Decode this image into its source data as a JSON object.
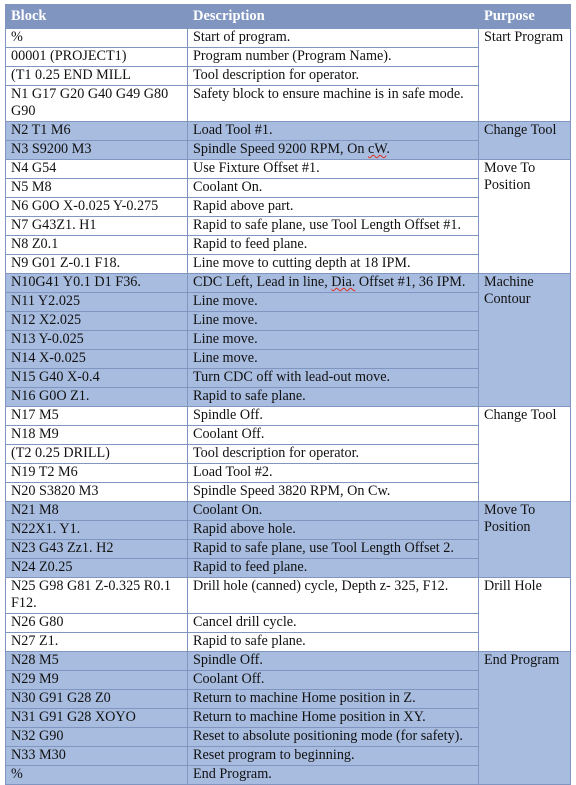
{
  "table": {
    "headers": {
      "block": "Block",
      "description": "Description",
      "purpose": "Purpose"
    },
    "rows": [
      {
        "block": "%",
        "description": "Start of program."
      },
      {
        "block": "00001 (PROJECT1)",
        "description": "Program number (Program Name)."
      },
      {
        "block": "(T1  0.25 END MILL",
        "description": "Tool description for operator."
      },
      {
        "block": "N1 G17 G20 G40 G49 G80 G90",
        "description": "Safety block to ensure machine is in safe mode."
      },
      {
        "block": "N2 T1 M6",
        "description": "Load Tool #1."
      },
      {
        "block": "N3  S9200 M3",
        "description": "Spindle Speed 9200 RPM, On cW."
      },
      {
        "block": "N4 G54",
        "description": "Use Fixture Offset #1."
      },
      {
        "block": "N5 M8",
        "description": "Coolant On."
      },
      {
        "block": "N6 G0O X-0.025 Y-0.275",
        "description": "Rapid above part."
      },
      {
        "block": "N7 G43Z1. H1",
        "description": "Rapid to safe plane, use Tool Length Offset #1."
      },
      {
        "block": "N8 Z0.1",
        "description": "Rapid to feed plane."
      },
      {
        "block": "N9 G01 Z-0.1 F18.",
        "description": "Line move to cutting depth at 18 IPM."
      },
      {
        "block": "N10G41 Y0.1 D1 F36.",
        "description": "CDC Left, Lead in line, Dia. Offset #1, 36 IPM."
      },
      {
        "block": "N11 Y2.025",
        "description": "Line move."
      },
      {
        "block": "N12 X2.025",
        "description": "Line move."
      },
      {
        "block": "N13 Y-0.025",
        "description": "Line move."
      },
      {
        "block": "N14 X-0.025",
        "description": "Line move."
      },
      {
        "block": "N15 G40 X-0.4",
        "description": "Turn CDC off with lead-out move."
      },
      {
        "block": "N16 G0O Z1.",
        "description": "Rapid to safe plane."
      },
      {
        "block": "N17 M5",
        "description": "Spindle Off."
      },
      {
        "block": "N18 M9",
        "description": "Coolant Off."
      },
      {
        "block": "(T2 0.25 DRILL)",
        "description": "Tool description for operator."
      },
      {
        "block": "N19 T2 M6",
        "description": "Load Tool #2."
      },
      {
        "block": "N20 S3820 M3",
        "description": "Spindle Speed 3820 RPM, On Cw."
      },
      {
        "block": "N21 M8",
        "description": "Coolant On."
      },
      {
        "block": "N22X1. Y1.",
        "description": "Rapid above hole."
      },
      {
        "block": "N23 G43 Zz1. H2",
        "description": "Rapid to safe plane, use Tool Length Offset 2."
      },
      {
        "block": "N24 Z0.25",
        "description": "Rapid to feed plane."
      },
      {
        "block": "N25 G98 G81 Z-0.325 R0.1 F12.",
        "description": "Drill hole (canned) cycle, Depth z- 325, F12."
      },
      {
        "block": "N26 G80",
        "description": "Cancel drill cycle."
      },
      {
        "block": "N27 Z1.",
        "description": "Rapid to safe plane."
      },
      {
        "block": "N28 M5",
        "description": "Spindle Off."
      },
      {
        "block": "N29 M9",
        "description": "Coolant Off."
      },
      {
        "block": "N30 G91 G28 Z0",
        "description": "Return to machine Home position in Z."
      },
      {
        "block": "N31 G91 G28 XOYO",
        "description": "Return to machine Home position in XY."
      },
      {
        "block": "N32 G90",
        "description": "Reset to absolute positioning mode (for safety)."
      },
      {
        "block": "N33 M30",
        "description": "Reset program to beginning."
      },
      {
        "block": "%",
        "description": "End Program."
      }
    ],
    "purposes": [
      {
        "label": "Start Program",
        "span": 4,
        "shaded": false
      },
      {
        "label": "Change Tool",
        "span": 2,
        "shaded": true
      },
      {
        "label": "Move To Position",
        "span": 6,
        "shaded": false
      },
      {
        "label": "Machine Contour",
        "span": 7,
        "shaded": true
      },
      {
        "label": "Change Tool",
        "span": 5,
        "shaded": false
      },
      {
        "label": "Move To Position",
        "span": 4,
        "shaded": true
      },
      {
        "label": "Drill Hole",
        "span": 3,
        "shaded": false
      },
      {
        "label": "End Program",
        "span": 7,
        "shaded": true
      }
    ],
    "colors": {
      "header_bg": "#8096c0",
      "header_text": "#ffffff",
      "shaded_row_bg": "#a8bcdf",
      "plain_row_bg": "#ffffff",
      "border": "#8096c0",
      "text": "#111111",
      "spellcheck_underline": "#e03020"
    },
    "spellcheck_words": [
      "cW",
      "Dia."
    ]
  }
}
